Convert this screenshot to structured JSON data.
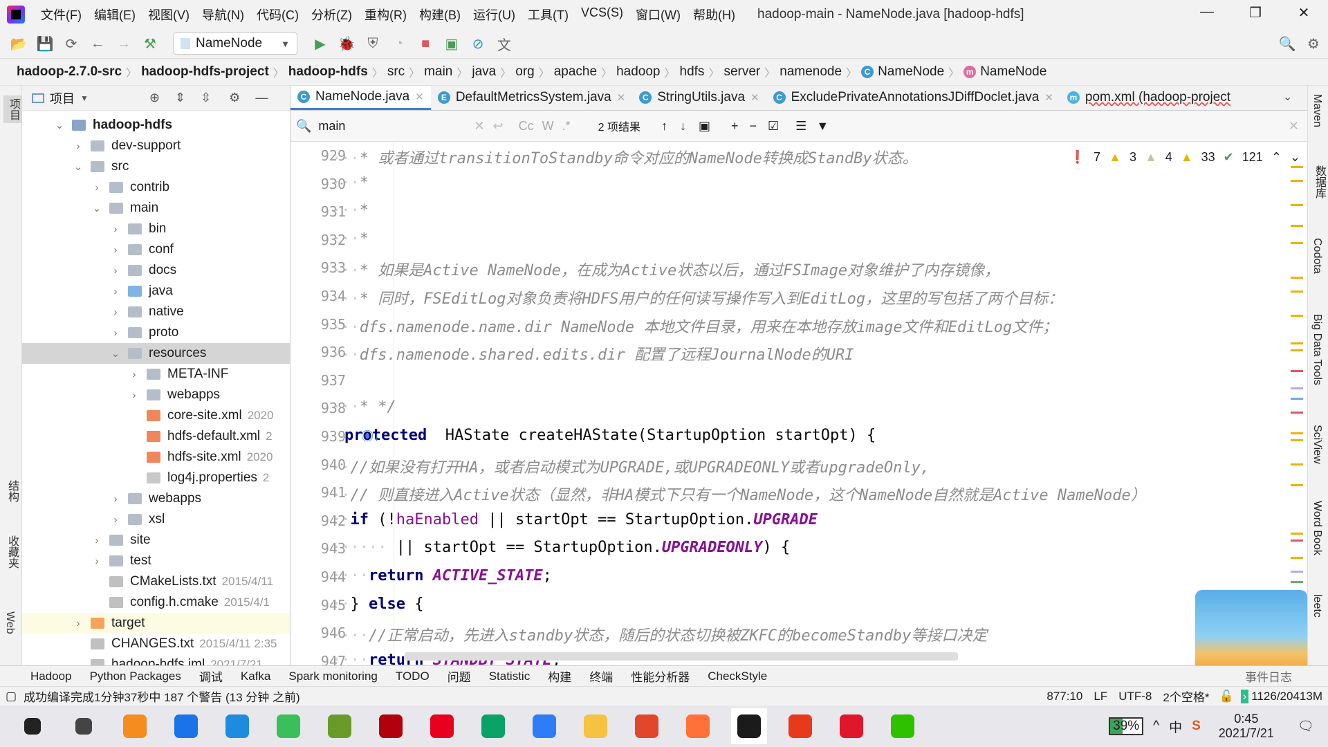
{
  "window": {
    "title": "hadoop-main - NameNode.java [hadoop-hdfs]",
    "menu": [
      "文件(F)",
      "编辑(E)",
      "视图(V)",
      "导航(N)",
      "代码(C)",
      "分析(Z)",
      "重构(R)",
      "构建(B)",
      "运行(U)",
      "工具(T)",
      "VCS(S)",
      "窗口(W)",
      "帮助(H)"
    ],
    "controls": [
      "—",
      "❐",
      "✕"
    ]
  },
  "toolbar": {
    "run_config": "NameNode"
  },
  "breadcrumb": [
    {
      "t": "hadoop-2.7.0-src",
      "b": true
    },
    {
      "t": "hadoop-hdfs-project",
      "b": true
    },
    {
      "t": "hadoop-hdfs",
      "b": true
    },
    {
      "t": "src"
    },
    {
      "t": "main"
    },
    {
      "t": "java"
    },
    {
      "t": "org"
    },
    {
      "t": "apache"
    },
    {
      "t": "hadoop"
    },
    {
      "t": "hdfs"
    },
    {
      "t": "server"
    },
    {
      "t": "namenode"
    },
    {
      "t": "NameNode"
    },
    {
      "t": "NameNode"
    }
  ],
  "left_strip": {
    "project": "项目",
    "structure": "结构",
    "favorites": "收藏夹",
    "web": "Web"
  },
  "project": {
    "title": "项目",
    "tree": [
      {
        "lv": 0,
        "name": "hadoop-hdfs",
        "kind": "module",
        "exp": true,
        "bold": true
      },
      {
        "lv": 1,
        "name": "dev-support",
        "kind": "folder",
        "exp": false
      },
      {
        "lv": 1,
        "name": "src",
        "kind": "folder",
        "exp": true
      },
      {
        "lv": 2,
        "name": "contrib",
        "kind": "folder",
        "exp": false
      },
      {
        "lv": 2,
        "name": "main",
        "kind": "folder",
        "exp": true
      },
      {
        "lv": 3,
        "name": "bin",
        "kind": "folder",
        "exp": false
      },
      {
        "lv": 3,
        "name": "conf",
        "kind": "folder",
        "exp": false
      },
      {
        "lv": 3,
        "name": "docs",
        "kind": "folder",
        "exp": false
      },
      {
        "lv": 3,
        "name": "java",
        "kind": "src",
        "exp": false
      },
      {
        "lv": 3,
        "name": "native",
        "kind": "folder",
        "exp": false
      },
      {
        "lv": 3,
        "name": "proto",
        "kind": "folder",
        "exp": false
      },
      {
        "lv": 3,
        "name": "resources",
        "kind": "res",
        "exp": true,
        "selected": true
      },
      {
        "lv": 4,
        "name": "META-INF",
        "kind": "folder",
        "exp": false
      },
      {
        "lv": 4,
        "name": "webapps",
        "kind": "folder",
        "exp": false
      },
      {
        "lv": 4,
        "name": "core-site.xml",
        "kind": "xml",
        "meta": "2020"
      },
      {
        "lv": 4,
        "name": "hdfs-default.xml",
        "kind": "xml",
        "meta": "2"
      },
      {
        "lv": 4,
        "name": "hdfs-site.xml",
        "kind": "xml",
        "meta": "2020"
      },
      {
        "lv": 4,
        "name": "log4j.properties",
        "kind": "props",
        "meta": "2"
      },
      {
        "lv": 3,
        "name": "webapps",
        "kind": "folder",
        "exp": false
      },
      {
        "lv": 3,
        "name": "xsl",
        "kind": "folder",
        "exp": false
      },
      {
        "lv": 2,
        "name": "site",
        "kind": "folder",
        "exp": false
      },
      {
        "lv": 2,
        "name": "test",
        "kind": "folder",
        "exp": false
      },
      {
        "lv": 2,
        "name": "CMakeLists.txt",
        "kind": "text",
        "meta": "2015/4/11"
      },
      {
        "lv": 2,
        "name": "config.h.cmake",
        "kind": "text",
        "meta": "2015/4/1"
      },
      {
        "lv": 1,
        "name": "target",
        "kind": "excluded",
        "exp": false,
        "highlight": true
      },
      {
        "lv": 1,
        "name": "CHANGES.txt",
        "kind": "text",
        "meta": "2015/4/11 2:35"
      },
      {
        "lv": 1,
        "name": "hadoop-hdfs.iml",
        "kind": "text",
        "meta": "2021/7/21"
      }
    ]
  },
  "tabs": [
    {
      "label": "NameNode.java",
      "icon": "C",
      "color": "#3d9ad1",
      "active": true
    },
    {
      "label": "DefaultMetricsSystem.java",
      "icon": "E",
      "color": "#3d9ad1"
    },
    {
      "label": "StringUtils.java",
      "icon": "C",
      "color": "#3d9ad1"
    },
    {
      "label": "ExcludePrivateAnnotationsJDiffDoclet.java",
      "icon": "C",
      "color": "#3d9ad1"
    },
    {
      "label": "pom.xml (hadoop-project",
      "icon": "m",
      "color": "#4eb3e0"
    }
  ],
  "search": {
    "value": "main",
    "options": [
      "Cc",
      "W",
      ".*"
    ],
    "results": "2 项结果"
  },
  "inspections": {
    "errors": "7",
    "warnings": "3",
    "weak": "4",
    "typos": "33",
    "ok": "121"
  },
  "code": [
    {
      "n": "929",
      "s": [
        [
          "dots",
          "···"
        ],
        [
          "cm",
          "* 或者通过transitionToStandby命令对应的NameNode转换成StandBy状态。"
        ]
      ]
    },
    {
      "n": "930",
      "s": [
        [
          "dots",
          "···"
        ],
        [
          "cm",
          "*"
        ]
      ]
    },
    {
      "n": "931",
      "s": [
        [
          "dots",
          "···"
        ],
        [
          "cm",
          "*"
        ]
      ]
    },
    {
      "n": "932",
      "s": [
        [
          "dots",
          "···"
        ],
        [
          "cm",
          "*"
        ]
      ]
    },
    {
      "n": "933",
      "s": [
        [
          "dots",
          "···"
        ],
        [
          "cm",
          "* 如果是Active NameNode，在成为Active状态以后，通过FSImage对象维护了内存镜像，"
        ]
      ]
    },
    {
      "n": "934",
      "s": [
        [
          "dots",
          "···"
        ],
        [
          "cm",
          "* 同时，FSEditLog对象负责将HDFS用户的任何读写操作写入到EditLog，这里的写包括了两个目标："
        ]
      ]
    },
    {
      "n": "935",
      "s": [
        [
          "dots",
          "···"
        ],
        [
          "cm",
          "dfs.namenode.name.dir NameNode 本地文件目录，用来在本地存放image文件和EditLog文件；"
        ]
      ]
    },
    {
      "n": "936",
      "s": [
        [
          "dots",
          "···"
        ],
        [
          "cm",
          "dfs.namenode.shared.edits.dir 配置了远程JournalNode的URI"
        ]
      ]
    },
    {
      "n": "937",
      "s": []
    },
    {
      "n": "938",
      "s": [
        [
          "dots",
          "···"
        ],
        [
          "cm",
          "* */"
        ]
      ]
    },
    {
      "n": "939",
      "s": [
        [
          "kw",
          "protected"
        ],
        [
          "",
          "  HAState createHAState(StartupOption startOpt) {"
        ]
      ]
    },
    {
      "n": "940",
      "s": [
        [
          "dots",
          "··"
        ],
        [
          "cm",
          "//如果没有打开HA，或者启动模式为UPGRADE,或UPGRADEONLY或者upgradeOnly,"
        ]
      ]
    },
    {
      "n": "941",
      "s": [
        [
          "dots",
          "··"
        ],
        [
          "cm",
          "// 则直接进入Active状态（显然，非HA模式下只有一个NameNode，这个NameNode自然就是Active NameNode）"
        ]
      ]
    },
    {
      "n": "942",
      "s": [
        [
          "dots",
          "··"
        ],
        [
          "kw",
          "if"
        ],
        [
          "",
          " (!"
        ],
        [
          "fd",
          "haEnabled"
        ],
        [
          "",
          " || startOpt == StartupOption."
        ],
        [
          "st",
          "UPGRADE"
        ]
      ]
    },
    {
      "n": "943",
      "s": [
        [
          "dots",
          "······"
        ],
        [
          "",
          " || startOpt == StartupOption."
        ],
        [
          "st",
          "UPGRADEONLY"
        ],
        [
          "",
          ") {"
        ]
      ]
    },
    {
      "n": "944",
      "s": [
        [
          "dots",
          "····"
        ],
        [
          "kw",
          "return"
        ],
        [
          "",
          " "
        ],
        [
          "st",
          "ACTIVE_STATE"
        ],
        [
          "",
          ";"
        ]
      ]
    },
    {
      "n": "945",
      "s": [
        [
          "dots",
          "··"
        ],
        [
          "",
          "} "
        ],
        [
          "kw",
          "else"
        ],
        [
          "",
          " {"
        ]
      ]
    },
    {
      "n": "946",
      "s": [
        [
          "dots",
          "····"
        ],
        [
          "cm",
          "//正常启动，先进入standby状态，随后的状态切换被ZKFC的becomeStandby等接口决定"
        ]
      ]
    },
    {
      "n": "947",
      "s": [
        [
          "dots",
          "····"
        ],
        [
          "kw",
          "return"
        ],
        [
          "",
          " "
        ],
        [
          "st",
          "STANDBY_STATE"
        ],
        [
          "",
          ";"
        ]
      ]
    }
  ],
  "right_strip": [
    "Maven",
    "数据库",
    "Codota",
    "Big Data Tools",
    "SciView",
    "Word Book",
    "leetc"
  ],
  "bottom_tools": [
    "Hadoop",
    "Python Packages",
    "调试",
    "Kafka",
    "Spark monitoring",
    "TODO",
    "问题",
    "Statistic",
    "构建",
    "终端",
    "性能分析器",
    "CheckStyle",
    "事件日志"
  ],
  "status": {
    "message": "成功编译完成1分钟37秒中 187 个警告 (13 分钟 之前)",
    "position": "877:10",
    "line_sep": "LF",
    "encoding": "UTF-8",
    "indent": "2个空格*",
    "memory": "1126/20413M"
  },
  "taskbar": {
    "apps": [
      {
        "name": "start",
        "color": "#222"
      },
      {
        "name": "search",
        "color": "#444"
      },
      {
        "name": "sublime-text",
        "color": "#f48c1f"
      },
      {
        "name": "maps",
        "color": "#1a73e8"
      },
      {
        "name": "app-blue-orange",
        "color": "#1d8be0"
      },
      {
        "name": "green-app",
        "color": "#3bbf5a"
      },
      {
        "name": "notepad",
        "color": "#6a9a2a"
      },
      {
        "name": "filezilla",
        "color": "#b3000d"
      },
      {
        "name": "youdao",
        "color": "#e8001e"
      },
      {
        "name": "player",
        "color": "#0aa267"
      },
      {
        "name": "wps-writer",
        "color": "#2f7df6"
      },
      {
        "name": "file-explorer",
        "color": "#f5c242"
      },
      {
        "name": "red-swirl",
        "color": "#e2462b"
      },
      {
        "name": "firefox",
        "color": "#ff7139"
      },
      {
        "name": "intellij-idea",
        "color": "#1b1b1b"
      },
      {
        "name": "xmind",
        "color": "#e8391c"
      },
      {
        "name": "red-notes",
        "color": "#e0162b"
      },
      {
        "name": "wechat",
        "color": "#2dc100"
      }
    ],
    "battery": "39%",
    "ime": "中",
    "time": "0:45",
    "date": "2021/7/21"
  }
}
